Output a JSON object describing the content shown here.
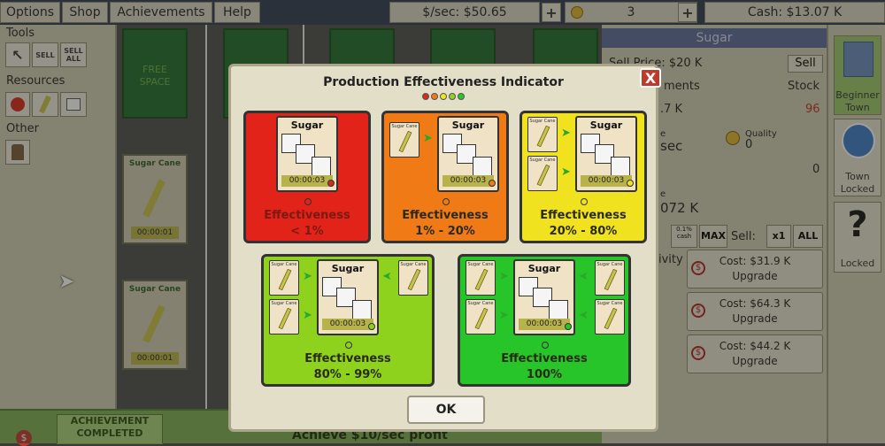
{
  "menu": {
    "options": "Options",
    "shop": "Shop",
    "achievements": "Achievements",
    "help": "Help"
  },
  "stats": {
    "income": "$/sec: $50.65",
    "tokens": "3",
    "cash": "Cash: $13.07 K",
    "plus": "+"
  },
  "left_panel": {
    "tools_title": "Tools",
    "sell": "SELL",
    "sell_all_1": "SELL",
    "sell_all_2": "ALL",
    "resources_title": "Resources",
    "other_title": "Other"
  },
  "map": {
    "free_space_1": "FREE",
    "free_space_2": "SPACE",
    "plots": [
      {
        "title": "Sugar Cane",
        "time": "00:00:01"
      },
      {
        "title": "Sugar Cane",
        "time": "00:00:01"
      }
    ],
    "bottom_badge_1": "ACHIEVEMENT",
    "bottom_badge_2": "COMPLETED",
    "bottom_text": "Achieve $10/sec profit"
  },
  "right_panel": {
    "header": "Sugar",
    "sell_price": "Sell Price: $20 K",
    "sell_btn": "Sell",
    "ments": "ments",
    "stock_label": "Stock",
    "k_value": ".7 K",
    "stock_value": "96",
    "e_label": "e",
    "sec_label": "sec",
    "quality_label": "Quality",
    "quality_value": "0",
    "zero_value": "0",
    "e2_label": "e",
    "val_072": "072 K",
    "cash_pct": "0.1% cash",
    "max": "MAX",
    "sell_label": "Sell:",
    "x1": "x1",
    "all": "ALL",
    "ivity": "ivity",
    "upgrades": [
      {
        "cost": "Cost: $31.9 K",
        "label": "Upgrade"
      },
      {
        "cost": "Cost: $64.3 K",
        "label": "Upgrade"
      },
      {
        "cost": "Cost: $44.2 K",
        "label": "Upgrade"
      }
    ]
  },
  "side": {
    "beginner_town_1": "Beginner",
    "beginner_town_2": "Town",
    "town_locked_1": "Town",
    "town_locked_2": "Locked",
    "locked_q": "?",
    "locked": "Locked"
  },
  "dialog": {
    "title": "Production Effectiveness Indicator",
    "close": "X",
    "factory_name": "Sugar",
    "factory_time": "00:00:03",
    "input_name": "Sugar Cane",
    "effectiveness": "Effectiveness",
    "cards": [
      {
        "range": "< 1%",
        "color": "#e2231a"
      },
      {
        "range": "1% - 20%",
        "color": "#f07a16"
      },
      {
        "range": "20% - 80%",
        "color": "#f0e21e"
      },
      {
        "range": "80% - 99%",
        "color": "#8ed21e"
      },
      {
        "range": "100%",
        "color": "#27c42a"
      }
    ],
    "dot_colors": [
      "#d9281e",
      "#f07a16",
      "#f0e21e",
      "#8ed21e",
      "#27c42a"
    ],
    "ok": "OK"
  }
}
